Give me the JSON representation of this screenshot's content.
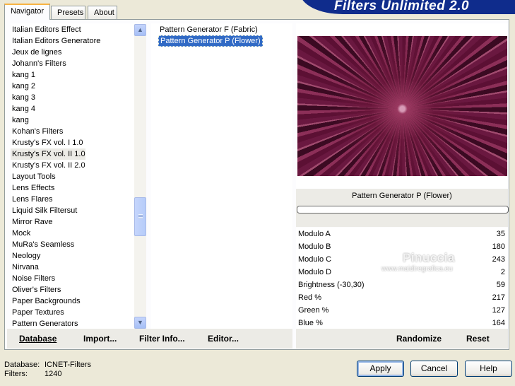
{
  "banner": {
    "title": "Filters Unlimited 2.0"
  },
  "tabs": [
    {
      "label": "Navigator"
    },
    {
      "label": "Presets"
    },
    {
      "label": "About"
    }
  ],
  "categories": [
    "Italian Editors Effect",
    "Italian Editors Generatore",
    "Jeux de lignes",
    "Johann's Filters",
    "kang 1",
    "kang 2",
    "kang 3",
    "kang 4",
    "kang",
    "Kohan's Filters",
    "Krusty's FX vol. I 1.0",
    "Krusty's FX vol. II 1.0",
    "Krusty's FX vol. II 2.0",
    "Layout Tools",
    "Lens Effects",
    "Lens Flares",
    "Liquid Silk Filtersut",
    "Mirror Rave",
    "Mock",
    "MuRa's Seamless",
    "Neology",
    "Nirvana",
    "Noise Filters",
    "Oliver's Filters",
    "Paper Backgrounds",
    "Paper Textures",
    "Pattern Generators"
  ],
  "selected_category": "Krusty's FX vol. II 1.0",
  "filters": [
    "Pattern Generator F (Fabric)",
    "Pattern Generator P (Flower)"
  ],
  "selected_filter": "Pattern Generator P (Flower)",
  "left_buttons": {
    "database": "Database",
    "import": "Import...",
    "filter_info": "Filter Info...",
    "editor": "Editor..."
  },
  "filter_title": "Pattern Generator P (Flower)",
  "params": [
    {
      "name": "Modulo A",
      "value": "35"
    },
    {
      "name": "Modulo B",
      "value": "180"
    },
    {
      "name": "Modulo C",
      "value": "243"
    },
    {
      "name": "Modulo D",
      "value": "2"
    },
    {
      "name": "Brightness (-30,30)",
      "value": "59"
    },
    {
      "name": "Red %",
      "value": "217"
    },
    {
      "name": "Green %",
      "value": "127"
    },
    {
      "name": "Blue %",
      "value": "164"
    }
  ],
  "right_buttons": {
    "randomize": "Randomize",
    "reset": "Reset"
  },
  "status": {
    "database_label": "Database:",
    "database_value": "ICNET-Filters",
    "filters_label": "Filters:",
    "filters_value": "1240"
  },
  "dialog_buttons": {
    "apply": "Apply",
    "cancel": "Cancel",
    "help": "Help"
  },
  "watermark": {
    "line1": "Pinuccia",
    "line2": "www.maidiregrafica.eu"
  }
}
